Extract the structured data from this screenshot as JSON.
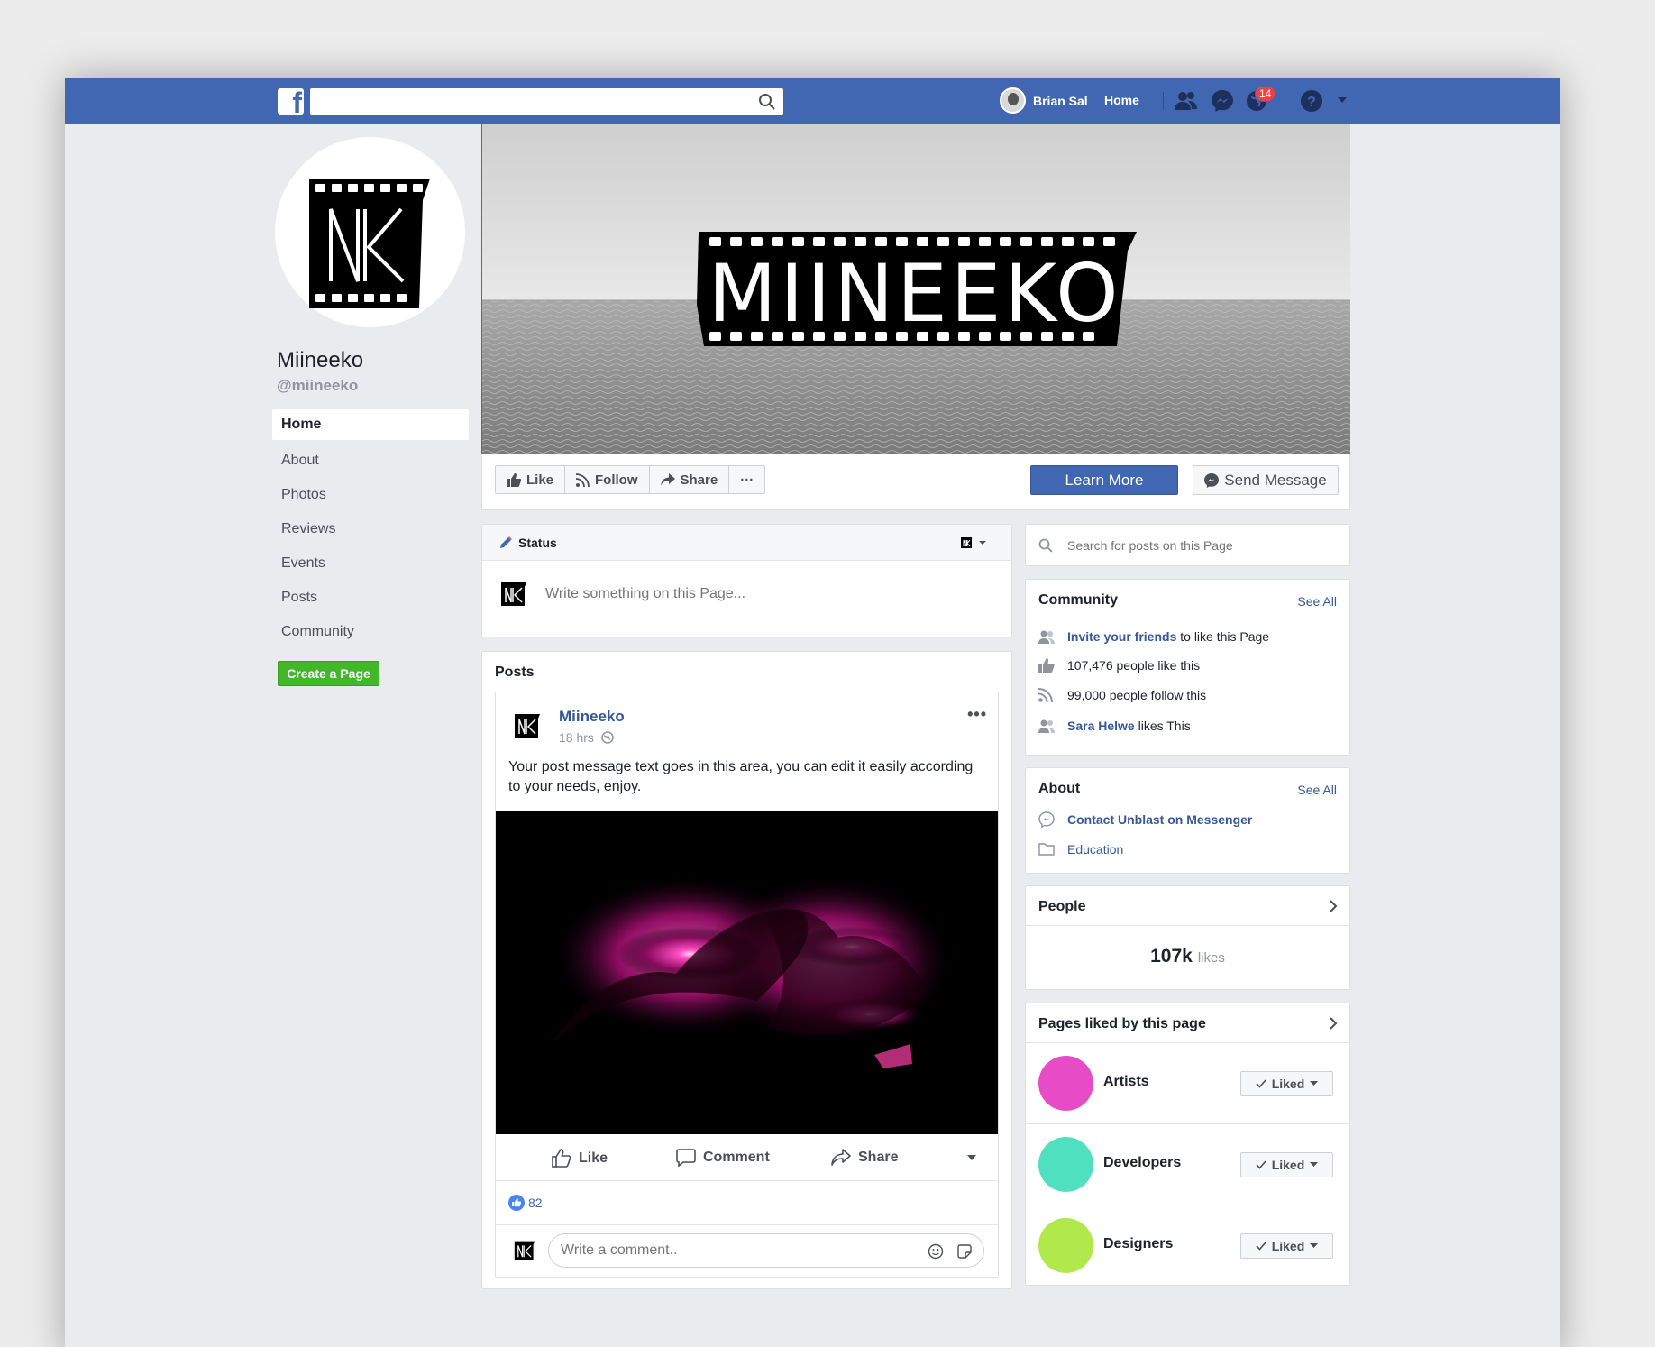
{
  "topbar": {
    "search_placeholder": "",
    "user_name": "Brian Sal",
    "home_label": "Home",
    "notification_count": "14"
  },
  "profile": {
    "name": "Miineeko",
    "handle": "@miineeko"
  },
  "left_nav": {
    "items": [
      {
        "label": "Home",
        "active": true
      },
      {
        "label": "About"
      },
      {
        "label": "Photos"
      },
      {
        "label": "Reviews"
      },
      {
        "label": "Events"
      },
      {
        "label": "Posts"
      },
      {
        "label": "Community"
      }
    ],
    "create_page_label": "Create a Page"
  },
  "cover": {
    "logo_text": "MIINEEKO"
  },
  "action_bar": {
    "like_label": "Like",
    "follow_label": "Follow",
    "share_label": "Share",
    "more_label": "···",
    "learn_more_label": "Learn More",
    "send_message_label": "Send Message"
  },
  "status": {
    "title": "Status",
    "placeholder": "Write something on this Page..."
  },
  "posts": {
    "title": "Posts",
    "post": {
      "author": "Miineeko",
      "time": "18 hrs",
      "text": "Your post message text goes in this area, you can edit it easily according to your needs, enjoy.",
      "like_label": "Like",
      "comment_label": "Comment",
      "share_label": "Share",
      "reaction_count": "82",
      "comment_placeholder": "Write a comment.."
    }
  },
  "right": {
    "search_placeholder": "Search for posts on this Page",
    "community": {
      "title": "Community",
      "see_all": "See All",
      "invite_link": "Invite your friends",
      "invite_rest": "to like this Page",
      "likes_text": "107,476 people like this",
      "follow_text": "99,000 people follow this",
      "friend_name": "Sara Helwe",
      "friend_rest": "likes This"
    },
    "about": {
      "title": "About",
      "see_all": "See All",
      "messenger": "Contact Unblast on Messenger",
      "category": "Education"
    },
    "people": {
      "title": "People",
      "likes_num": "107k",
      "likes_label": "likes"
    },
    "pages_liked": {
      "title": "Pages liked by this page",
      "liked_label": "Liked",
      "items": [
        {
          "name": "Artists",
          "color": "#e84bc6"
        },
        {
          "name": "Developers",
          "color": "#4fe0bf"
        },
        {
          "name": "Designers",
          "color": "#b1e84b"
        }
      ]
    }
  },
  "colors": {
    "brand_blue": "#4267b2",
    "link_blue": "#365899",
    "green": "#42b72a"
  }
}
